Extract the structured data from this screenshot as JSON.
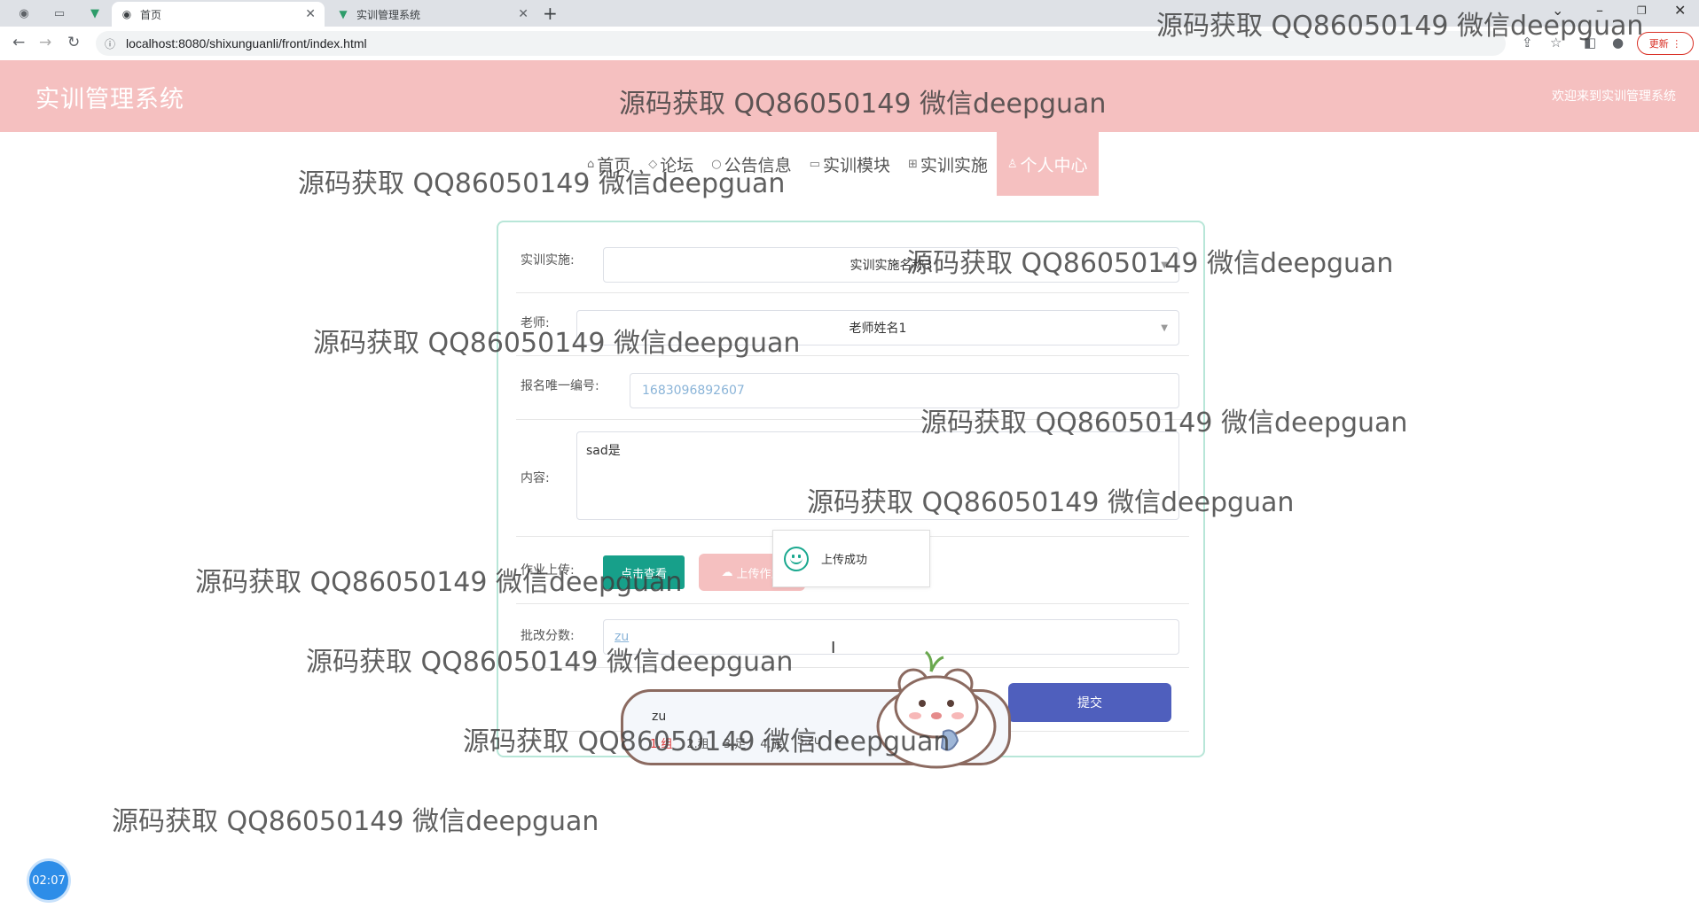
{
  "browser": {
    "tabs": [
      {
        "label": "首页",
        "active": true
      },
      {
        "label": "实训管理系统",
        "active": false
      }
    ],
    "url": "localhost:8080/shixunguanli/front/index.html",
    "update_label": "更新"
  },
  "header": {
    "title": "实训管理系统",
    "welcome": "欢迎来到实训管理系统"
  },
  "nav": {
    "items": [
      {
        "label": "首页",
        "icon": "home-icon"
      },
      {
        "label": "论坛",
        "icon": "tag-icon"
      },
      {
        "label": "公告信息",
        "icon": "bulletin-icon"
      },
      {
        "label": "实训模块",
        "icon": "book-icon"
      },
      {
        "label": "实训实施",
        "icon": "grid-icon"
      },
      {
        "label": "个人中心",
        "icon": "user-icon",
        "active": true
      }
    ]
  },
  "form": {
    "training_label": "实训实施:",
    "training_value": "实训实施名称3",
    "teacher_label": "老师:",
    "teacher_value": "老师姓名1",
    "regno_label": "报名唯一编号:",
    "regno_value": "1683096892607",
    "content_label": "内容:",
    "content_value": "sad是",
    "upload_label": "作业上传:",
    "view_button": "点击查看",
    "upload_button": "上传作业",
    "score_label": "批改分数:",
    "score_value": "zu",
    "submit_button": "提交"
  },
  "toast": {
    "text": "上传成功"
  },
  "ime": {
    "composition": "zu",
    "candidates": [
      "1.组",
      "2.租",
      "3.足",
      "4.族",
      "5.zu"
    ]
  },
  "timer": "02:07",
  "watermark": "源码获取 QQ86050149 微信deepguan",
  "colors": {
    "header_bg": "#f5c0c0",
    "view_button": "#17a08a",
    "submit_button": "#4f5fbd",
    "card_border": "#b8e6d8"
  }
}
